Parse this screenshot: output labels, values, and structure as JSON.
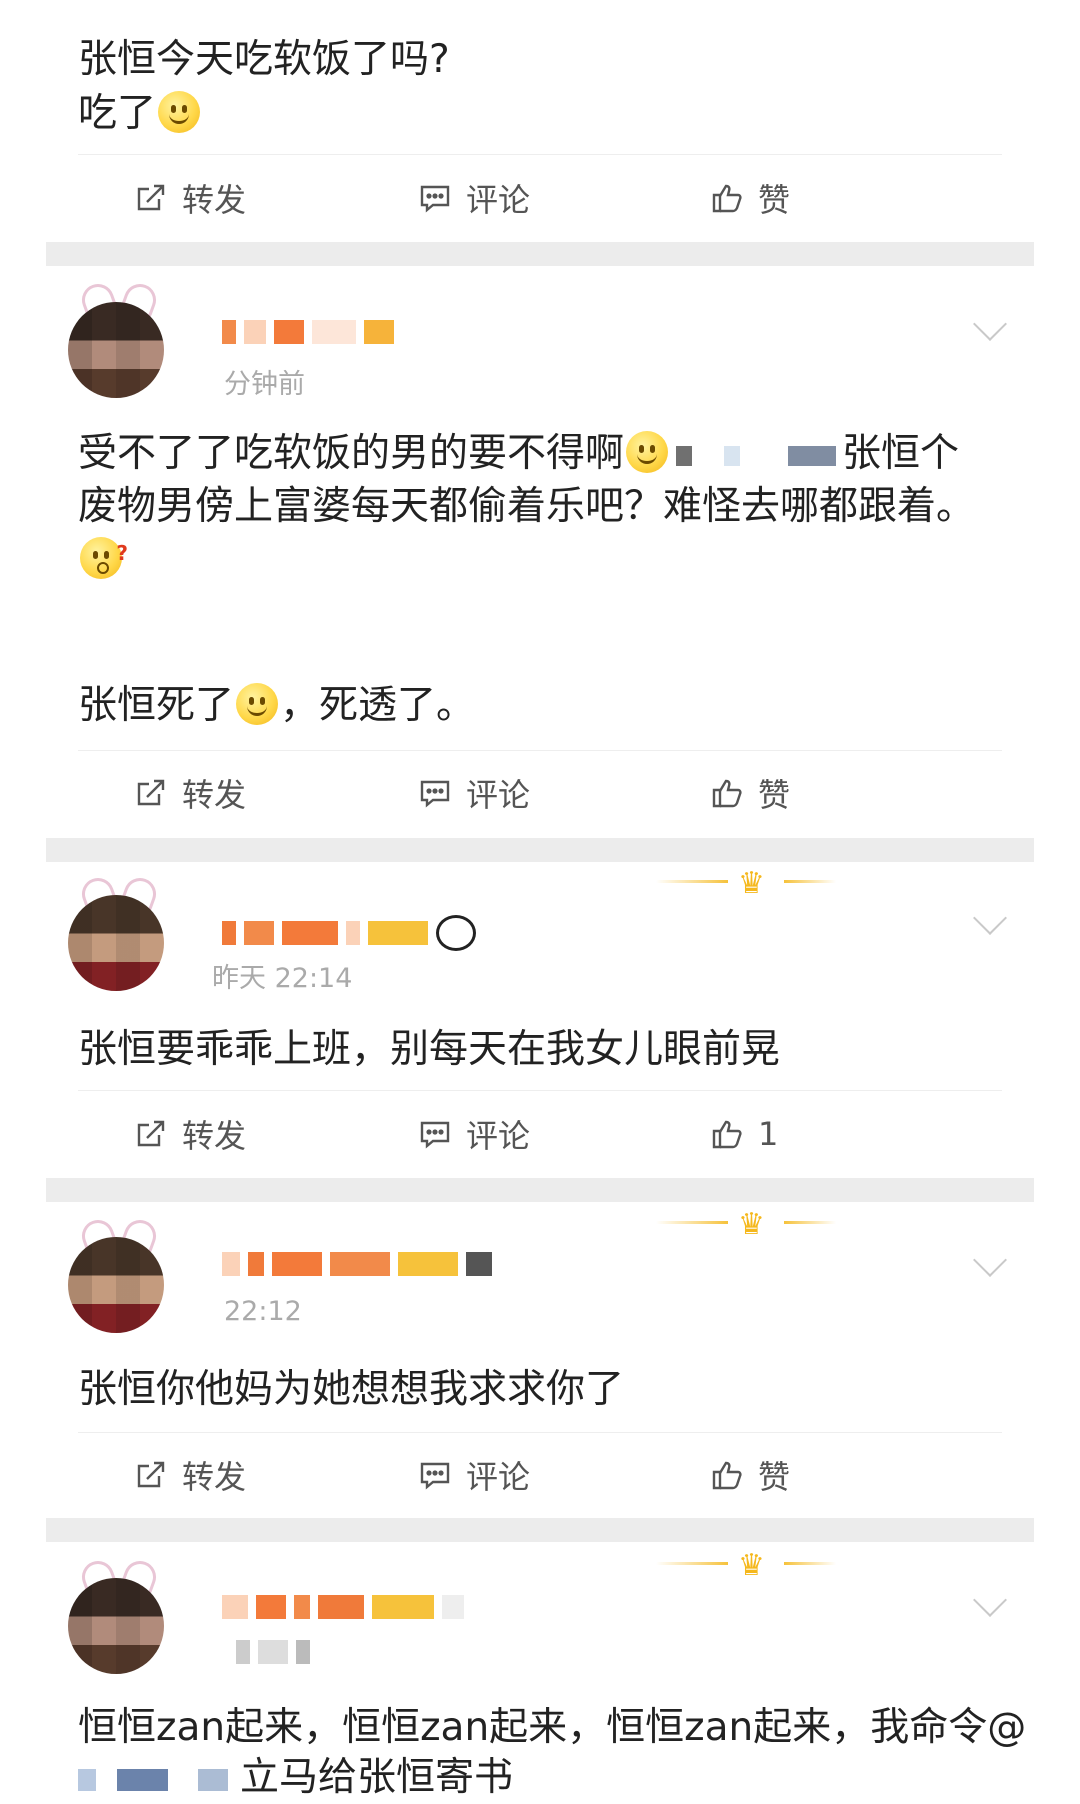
{
  "post1": {
    "line1": "张恒今天吃软饭了吗?",
    "line2": "吃了",
    "actions": {
      "repost": "转发",
      "comment": "评论",
      "like": "赞"
    }
  },
  "post2": {
    "time": "分钟前",
    "body_line1_a": "受不了了吃软饭的男的要不得啊",
    "body_line1_b": "张恒个",
    "body_line2": "废物男傍上富婆每天都偷着乐吧？难怪去哪都跟着。",
    "body_line3_a": "张恒死了",
    "body_line3_b": "，死透了。",
    "actions": {
      "repost": "转发",
      "comment": "评论",
      "like": "赞"
    }
  },
  "post3": {
    "time": "昨天 22:14",
    "body": "张恒要乖乖上班，别每天在我女儿眼前晃",
    "actions": {
      "repost": "转发",
      "comment": "评论",
      "like": "1"
    }
  },
  "post4": {
    "time": "22:12",
    "body": "张恒你他妈为她想想我求求你了",
    "actions": {
      "repost": "转发",
      "comment": "评论",
      "like": "赞"
    }
  },
  "post5": {
    "body_line1": "恒恒zan起来，恒恒zan起来，恒恒zan起来，我命令@",
    "body_line2": "立马给张恒寄书"
  },
  "colors": {
    "separator": "#ececec",
    "text": "#222222",
    "meta": "#aaaaaa",
    "crown": "#f5b81d"
  }
}
